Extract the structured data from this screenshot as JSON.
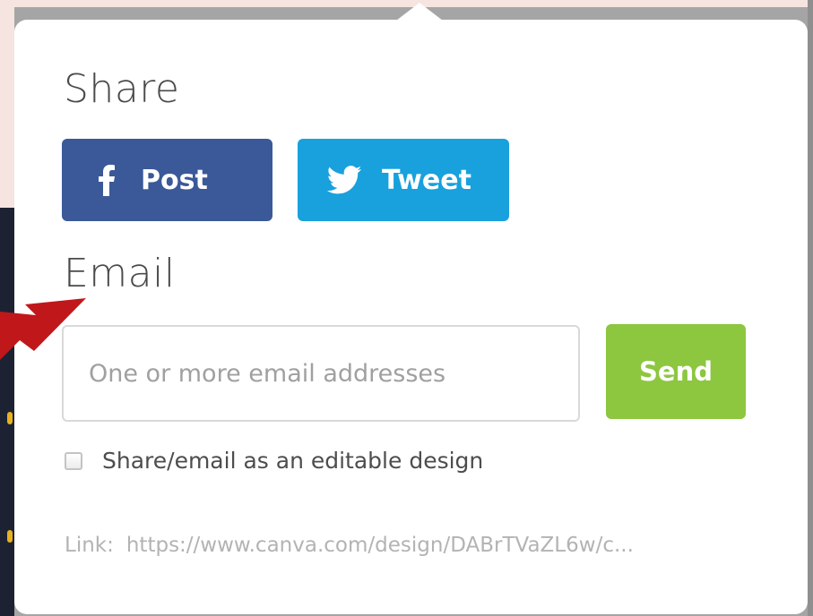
{
  "share": {
    "title": "Share",
    "facebook_label": "Post",
    "twitter_label": "Tweet"
  },
  "email": {
    "title": "Email",
    "input_placeholder": "One or more email addresses",
    "send_label": "Send",
    "editable_checkbox_label": "Share/email as an editable design",
    "editable_checked": false
  },
  "link": {
    "label": "Link:",
    "url": "https://www.canva.com/design/DABrTVaZL6w/c..."
  },
  "colors": {
    "facebook": "#3b5998",
    "twitter": "#18a1dc",
    "send": "#8dc63f",
    "annotation_arrow": "#c0171b"
  },
  "icons": {
    "facebook": "facebook-icon",
    "twitter": "twitter-icon"
  }
}
